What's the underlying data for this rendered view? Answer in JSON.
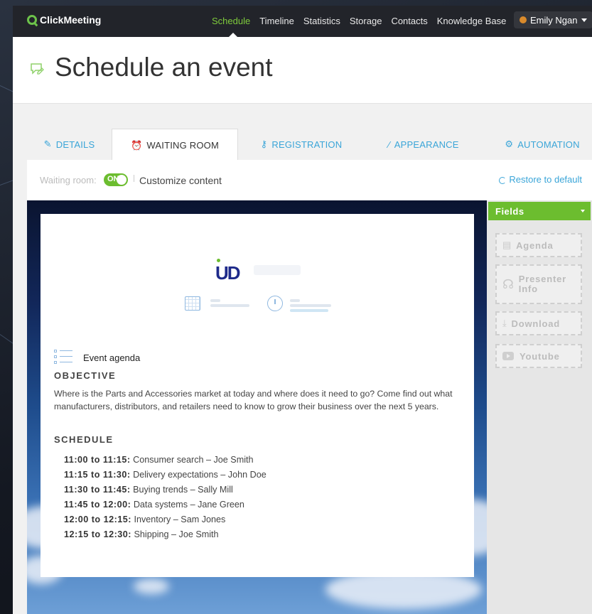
{
  "app": {
    "logo_text": "ClickMeeting",
    "brand_color": "#6cbd2f",
    "link_color": "#3aa5d8"
  },
  "nav": {
    "items": [
      {
        "label": "Schedule",
        "active": true
      },
      {
        "label": "Timeline",
        "active": false
      },
      {
        "label": "Statistics",
        "active": false
      },
      {
        "label": "Storage",
        "active": false
      },
      {
        "label": "Contacts",
        "active": false
      },
      {
        "label": "Knowledge Base",
        "active": false
      }
    ],
    "user_name": "Emily Ngan"
  },
  "page": {
    "title": "Schedule an event"
  },
  "tabs": [
    {
      "label": "DETAILS",
      "icon": "pencil-icon",
      "active": false
    },
    {
      "label": "WAITING ROOM",
      "icon": "alarm-clock-icon",
      "active": true
    },
    {
      "label": "REGISTRATION",
      "icon": "key-icon",
      "active": false
    },
    {
      "label": "APPEARANCE",
      "icon": "brush-icon",
      "active": false
    },
    {
      "label": "AUTOMATION",
      "icon": "gear-icon",
      "active": false
    }
  ],
  "waiting_room": {
    "label": "Waiting room:",
    "toggle_text": "ON",
    "toggle_on": true,
    "customize_label": "Customize content",
    "restore_label": "Restore to default"
  },
  "preview": {
    "logo_text": "UD",
    "agenda_title": "Event agenda",
    "objective_heading": "OBJECTIVE",
    "objective_text": "Where is the Parts and Accessories market at today and where does it need to go? Come find out what manufacturers, distributors, and retailers need to know to grow their business over the next 5 years.",
    "schedule_heading": "SCHEDULE",
    "schedule": [
      {
        "time": "11:00 to 11:15:",
        "desc": "Consumer search – Joe Smith"
      },
      {
        "time": "11:15 to 11:30:",
        "desc": "Delivery expectations – John Doe"
      },
      {
        "time": "11:30 to 11:45:",
        "desc": "Buying trends – Sally Mill"
      },
      {
        "time": "11:45 to 12:00:",
        "desc": "Data systems – Jane Green"
      },
      {
        "time": "12:00 to 12:15:",
        "desc": "Inventory – Sam Jones"
      },
      {
        "time": "12:15 to 12:30:",
        "desc": "Shipping – Joe Smith"
      }
    ]
  },
  "fields_panel": {
    "title": "Fields",
    "items": [
      {
        "label": "Agenda",
        "icon": "agenda-icon"
      },
      {
        "label": "Presenter Info",
        "icon": "headset-icon"
      },
      {
        "label": "Download",
        "icon": "download-icon"
      },
      {
        "label": "Youtube",
        "icon": "youtube-icon"
      }
    ]
  }
}
